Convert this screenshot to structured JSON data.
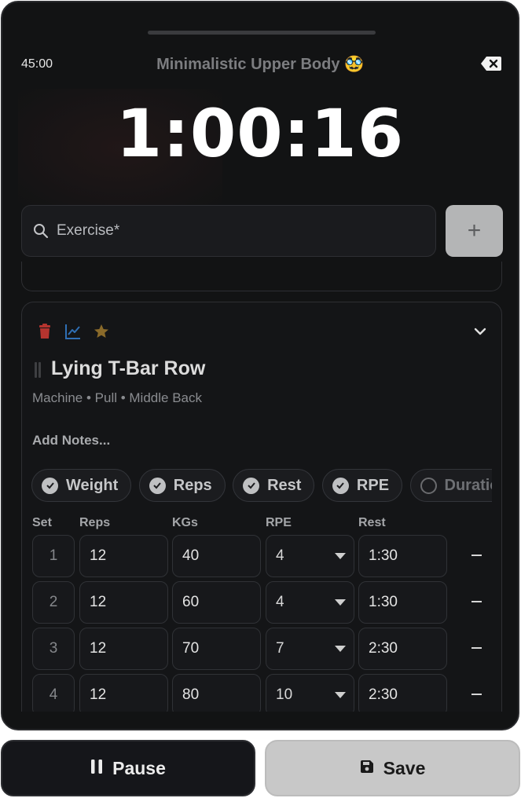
{
  "header": {
    "elapsed": "45:00",
    "title": "Minimalistic Upper Body 🥸",
    "timer": "1:00:16"
  },
  "search": {
    "placeholder": "Exercise*"
  },
  "add_button_label": "+",
  "exercise": {
    "name": "Lying T-Bar Row",
    "meta": "Machine • Pull • Middle Back",
    "notes_label": "Add Notes...",
    "icons": [
      "trash-icon",
      "chart-icon",
      "star-icon",
      "chevron-down-icon",
      "drag-handle-icon"
    ],
    "chips": [
      {
        "label": "Weight",
        "enabled": true
      },
      {
        "label": "Reps",
        "enabled": true
      },
      {
        "label": "Rest",
        "enabled": true
      },
      {
        "label": "RPE",
        "enabled": true
      },
      {
        "label": "Duratio",
        "enabled": false
      }
    ],
    "columns": {
      "set": "Set",
      "reps": "Reps",
      "kgs": "KGs",
      "rpe": "RPE",
      "rest": "Rest"
    },
    "sets": [
      {
        "set": "1",
        "reps": "12",
        "kgs": "40",
        "rpe": "4",
        "rest": "1:30"
      },
      {
        "set": "2",
        "reps": "12",
        "kgs": "60",
        "rpe": "4",
        "rest": "1:30"
      },
      {
        "set": "3",
        "reps": "12",
        "kgs": "70",
        "rpe": "7",
        "rest": "2:30"
      },
      {
        "set": "4",
        "reps": "12",
        "kgs": "80",
        "rpe": "10",
        "rest": "2:30"
      }
    ]
  },
  "footer": {
    "pause_label": "Pause",
    "save_label": "Save"
  },
  "colors": {
    "background": "#121314",
    "trash": "#b5342f",
    "chart": "#2f6fb5",
    "star": "#8a6a2a",
    "save_button": "#c8c8c8"
  }
}
